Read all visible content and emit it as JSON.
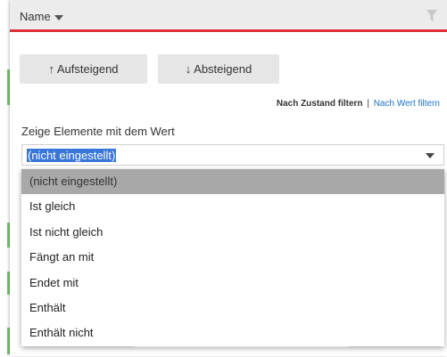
{
  "header": {
    "title": "Name"
  },
  "sort": {
    "ascending": "↑ Aufsteigend",
    "descending": "↓ Absteigend"
  },
  "filter_links": {
    "by_state": "Nach Zustand filtern",
    "separator": "|",
    "by_value": "Nach Wert filtern"
  },
  "show_label": "Zeige Elemente mit dem Wert",
  "select": {
    "value": "(nicht eingestellt)"
  },
  "options": [
    "(nicht eingestellt)",
    "Ist gleich",
    "Ist nicht gleich",
    "Fängt an mit",
    "Endet mit",
    "Enthält",
    "Enthält nicht"
  ],
  "colors": {
    "accent": "#e0303a",
    "link": "#1a73c9",
    "selection": "#3876d8",
    "hover": "#a8a8a8"
  }
}
